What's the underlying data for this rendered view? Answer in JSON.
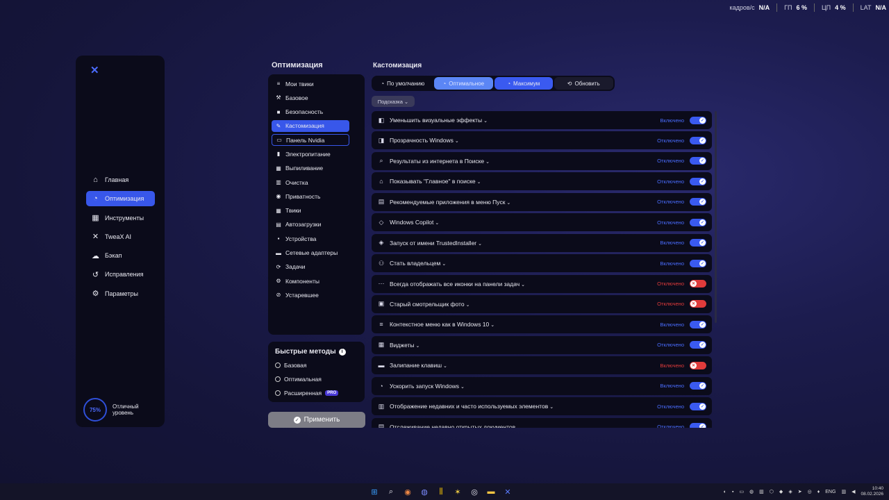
{
  "overlay": {
    "fps_label": "кадров/с",
    "fps_value": "N/A",
    "gpu_label": "ГП",
    "gpu_value": "6 %",
    "cpu_label": "ЦП",
    "cpu_value": "4 %",
    "lat_label": "LAT",
    "lat_value": "N/A"
  },
  "sidebar": {
    "logo": "✕",
    "items": [
      {
        "label": "Главная",
        "icon": "home-icon"
      },
      {
        "label": "Оптимизация",
        "icon": "gauge-icon"
      },
      {
        "label": "Инструменты",
        "icon": "grid-icon"
      },
      {
        "label": "TweaX AI",
        "icon": "ai-icon"
      },
      {
        "label": "Бэкап",
        "icon": "cloud-icon"
      },
      {
        "label": "Исправления",
        "icon": "history-icon"
      },
      {
        "label": "Параметры",
        "icon": "gear-icon"
      }
    ],
    "level": {
      "value": "75%",
      "label": "Отличный уровень"
    }
  },
  "categories": {
    "title": "Оптимизация",
    "items": [
      "Мои твики",
      "Базовое",
      "Безопасность",
      "Кастомизация",
      "Панель Nvidia",
      "Электропитание",
      "Выпиливание",
      "Очистка",
      "Приватность",
      "Твики",
      "Автозагрузки",
      "Устройства",
      "Сетевые адаптеры",
      "Задачи",
      "Компоненты",
      "Устаревшее"
    ]
  },
  "quick": {
    "title": "Быстрые методы",
    "items": [
      "Базовая",
      "Оптимальная",
      "Расширенная"
    ],
    "pro_badge": "PRO"
  },
  "apply_label": "Применить",
  "main": {
    "title": "Кастомизация",
    "presets": {
      "default": "По умолчанию",
      "optimal": "Оптимальное",
      "max": "Максимум",
      "refresh": "Обновить"
    },
    "hint": "Подсказка",
    "rows": [
      {
        "label": "Уменьшить визуальные эффекты",
        "status": "Включено",
        "state": "on"
      },
      {
        "label": "Прозрачность Windows",
        "status": "Отключено",
        "state": "on"
      },
      {
        "label": "Результаты из интернета в Поиске",
        "status": "Отключено",
        "state": "on"
      },
      {
        "label": "Показывать \"Главное\" в поиске",
        "status": "Отключено",
        "state": "on"
      },
      {
        "label": "Рекомендуемые приложения в меню Пуск",
        "status": "Отключено",
        "state": "on"
      },
      {
        "label": "Windows Copilot",
        "status": "Отключено",
        "state": "on"
      },
      {
        "label": "Запуск от имени TrustedInstaller",
        "status": "Включено",
        "state": "on"
      },
      {
        "label": "Стать владельцем",
        "status": "Включено",
        "state": "on"
      },
      {
        "label": "Всегда отображать все иконки на панели задач",
        "status": "Отключено",
        "state": "red"
      },
      {
        "label": "Старый смотрельщик фото",
        "status": "Отключено",
        "state": "red"
      },
      {
        "label": "Контекстное меню как в Windows 10",
        "status": "Включено",
        "state": "on"
      },
      {
        "label": "Виджеты",
        "status": "Отключено",
        "state": "on"
      },
      {
        "label": "Залипание клавиш",
        "status": "Включено",
        "state": "red"
      },
      {
        "label": "Ускорить запуск Windows",
        "status": "Включено",
        "state": "on"
      },
      {
        "label": "Отображение недавних и часто используемых элементов",
        "status": "Отключено",
        "state": "on"
      },
      {
        "label": "Отслеживание недавно открытых документов",
        "status": "Отключено",
        "state": "on"
      }
    ]
  },
  "taskbar": {
    "lang": "ENG",
    "time": "10:40",
    "date": "08.02.2026"
  },
  "colors": {
    "accent": "#3857ea",
    "red": "#e03b3b",
    "panel": "#0b0b1a"
  }
}
